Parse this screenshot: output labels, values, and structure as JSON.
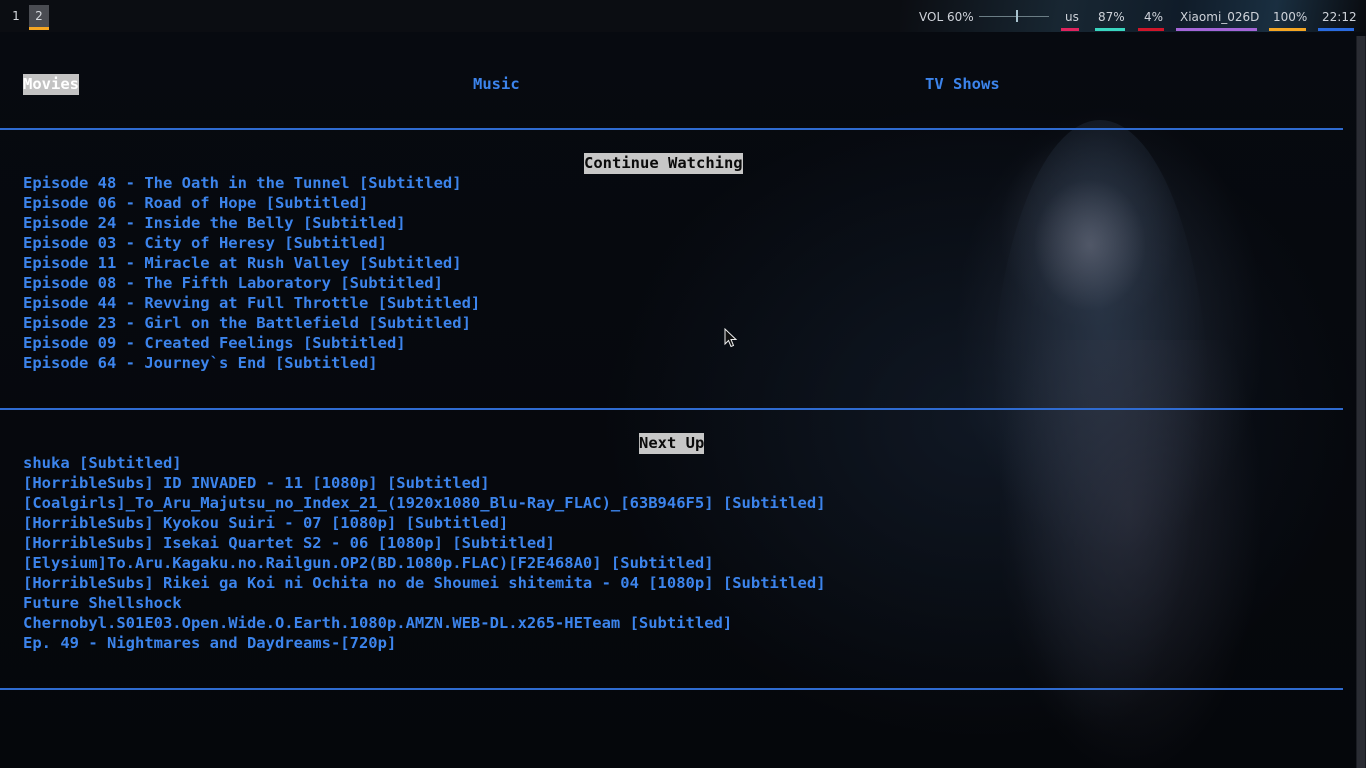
{
  "workspaces": [
    {
      "label": "1",
      "active": false
    },
    {
      "label": "2",
      "active": true
    }
  ],
  "status": {
    "volume": "VOL 60%",
    "volume_level": 0.6,
    "layout": "us",
    "battery": "87%",
    "cpu": "4%",
    "wifi": "Xiaomi_026D",
    "brightness": "100%",
    "clock": "22:12"
  },
  "colors": {
    "accent": "#3c84ec",
    "rule": "#2f6bd0",
    "selected_bg": "#c3c3c3",
    "ws_underline": "#f5a623",
    "u_layout": "#e0245e",
    "u_battery": "#3ad6c0",
    "u_cpu": "#d0162a",
    "u_wifi": "#a466d8",
    "u_brightness": "#f5a623",
    "u_clock": "#2a6be0"
  },
  "menu": {
    "movies": "Movies",
    "music": "Music",
    "tv_shows": "TV Shows"
  },
  "continue_watching": {
    "title": "Continue Watching",
    "items": [
      "Episode 48 - The Oath in the Tunnel [Subtitled]",
      "Episode 06 - Road of Hope [Subtitled]",
      "Episode 24 - Inside the Belly [Subtitled]",
      "Episode 03 - City of Heresy [Subtitled]",
      "Episode 11 - Miracle at Rush Valley [Subtitled]",
      "Episode 08 - The Fifth Laboratory [Subtitled]",
      "Episode 44 - Revving at Full Throttle [Subtitled]",
      "Episode 23 - Girl on the Battlefield [Subtitled]",
      "Episode 09 - Created Feelings [Subtitled]",
      "Episode 64 - Journey`s End [Subtitled]"
    ]
  },
  "next_up": {
    "title": "Next Up",
    "items": [
      "shuka [Subtitled]",
      "[HorribleSubs] ID INVADED - 11 [1080p] [Subtitled]",
      "[Coalgirls]_To_Aru_Majutsu_no_Index_21_(1920x1080_Blu-Ray_FLAC)_[63B946F5] [Subtitled]",
      "[HorribleSubs] Kyokou Suiri - 07 [1080p] [Subtitled]",
      "[HorribleSubs] Isekai Quartet S2 - 06 [1080p] [Subtitled]",
      "[Elysium]To.Aru.Kagaku.no.Railgun.OP2(BD.1080p.FLAC)[F2E468A0] [Subtitled]",
      "[HorribleSubs] Rikei ga Koi ni Ochita no de Shoumei shitemita - 04 [1080p] [Subtitled]",
      "Future Shellshock",
      "Chernobyl.S01E03.Open.Wide.O.Earth.1080p.AMZN.WEB-DL.x265-HETeam [Subtitled]",
      "Ep. 49 - Nightmares and Daydreams-[720p]"
    ]
  }
}
